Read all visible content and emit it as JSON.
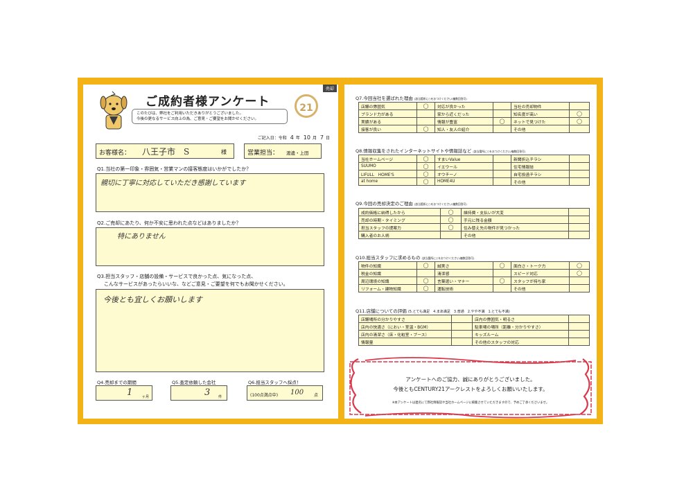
{
  "left": {
    "tag": "売却",
    "title": "ご成約者様アンケート",
    "logo": "21",
    "bubble": [
      "このたびは、弊社をご利用いただきありがとうございました。",
      "今後の更なるサービス向上の為、ご意見・ご要望をお聞かせください。"
    ],
    "date": {
      "prefix": "ご記入日：令和",
      "year": "4",
      "year_unit": "年",
      "month": "10",
      "month_unit": "月",
      "day": "7",
      "day_unit": "日"
    },
    "customer_label": "お客様名：",
    "customer_name": "八王子市　S",
    "customer_suffix": "様",
    "staff_label": "営業担当：",
    "staff_name": "渡邊・上田",
    "q1": "Q1.当社の第一印象・雰囲気・営業マンの接客態度はいかがでしたか？",
    "a1": "親切に丁寧に対応していただき感謝しています",
    "q2": "Q2.ご売却にあたり、何か不安に思われた点などはありましたか？",
    "a2": "特にありません",
    "q3_line1": "Q3.担当スタッフ・店舗の設備・サービスで良かった点、気になった点、",
    "q3_line2": "こんなサービスがあったらいいな、などご意見・ご要望を何でもお聞かせください。",
    "a3": "今後とも宜しくお願いします",
    "q4": "Q4.売却までの期間",
    "a4": "1",
    "a4_unit": "ヶ月",
    "q5": "Q5.査定依頼した会社",
    "a5": "3",
    "a5_unit": "件",
    "q6": "Q6.担当スタッフへ採点！",
    "q6_scale": "(100点満点中)",
    "a6": "100",
    "a6_unit": "点"
  },
  "right": {
    "q7": {
      "title": "Q7.今回当社を選ばれた理由",
      "note": "(該当箇所に○をおつけください/複数回答可)",
      "rows": [
        [
          "店舗の雰囲気",
          "◯",
          "対応が良かった",
          "",
          "当社の売却物件",
          ""
        ],
        [
          "ブランド力がある",
          "",
          "家から近くだった",
          "",
          "知名度が高い",
          "◯"
        ],
        [
          "実績がある",
          "",
          "情報が豊富",
          "◯",
          "ネットで見つけた",
          "◯"
        ],
        [
          "接客が良い",
          "◯",
          "知人・友人の紹介",
          "",
          "その他",
          ""
        ]
      ]
    },
    "q8": {
      "title": "Q8.情報収集をされたインターネットサイトや情報誌など",
      "note": "(該当箇所に○をおつけください/複数回答可)",
      "rows": [
        [
          "当社ホームページ",
          "◯",
          "すまいValue",
          "",
          "新聞折込チラシ",
          ""
        ],
        [
          "SUUMO",
          "◯",
          "イエウール",
          "",
          "住宅情報誌",
          ""
        ],
        [
          "LIFULL　HOME'S",
          "◯",
          "オウチーノ",
          "",
          "自宅投函チラシ",
          ""
        ],
        [
          "at home",
          "◯",
          "HOME4U",
          "",
          "その他",
          ""
        ]
      ]
    },
    "q9": {
      "title": "Q9.今回の売却決定のご理由",
      "note": "(該当箇所に○をおつけください/複数回答可)",
      "rows": [
        [
          "成約価格に納得したから",
          "◯",
          "維持費・支払いが大変",
          ""
        ],
        [
          "売却の時期・タイミング",
          "◯",
          "手元に残る金額",
          ""
        ],
        [
          "担当スタッフの提案力",
          "◯",
          "住み替え先の物件が見つかった",
          ""
        ],
        [
          "購入者のお人柄",
          "",
          "その他",
          ""
        ]
      ]
    },
    "q10": {
      "title": "Q10.担当スタッフに求めるもの",
      "note": "(該当箇所に○をおつけください/複数回答可)",
      "rows": [
        [
          "物件の知識",
          "◯",
          "誠実さ",
          "◯",
          "面白さ・トーク力",
          "◯"
        ],
        [
          "税金の知識",
          "",
          "清潔感",
          "",
          "スピード対応",
          "◯"
        ],
        [
          "周辺環境の知識",
          "◯",
          "言葉遣い・マナー",
          "◯",
          "スタッフが持ち家",
          ""
        ],
        [
          "リフォーム・建物知識",
          "◯",
          "運転技術",
          "",
          "その他",
          ""
        ]
      ]
    },
    "q11": {
      "title": "Q11.店舗についての評価",
      "note": "(5.とても満足　4.まあ満足　3.普通　2.やや不満　1.とても不満)",
      "rows": [
        [
          "店舗場所の分かりやすさ",
          "",
          "店内の雰囲気・明るさ",
          ""
        ],
        [
          "店内の快適さ（におい・室温・BGM）",
          "",
          "駐車場の場所（距離・分かりやすさ）",
          ""
        ],
        [
          "店内の清潔さ（床・化粧室・ブース）",
          "",
          "キッズルーム",
          ""
        ],
        [
          "情報量",
          "",
          "その他のスタッフの対応",
          ""
        ]
      ]
    },
    "thanks1": "アンケートへのご協力、誠にありがとうございました。",
    "thanks2": "今後ともCENTURY21アークレストをよろしくお願いいたします。",
    "footnote": "※本アンケートは匿名にて弊社情報誌や当社ホームページに掲載させていただきますので、予めご了承くださいませ。"
  },
  "colors": {
    "frame": "#f3b316",
    "field": "#fffbd0",
    "ribbon": "#d9374a",
    "logo": "#c8a463"
  }
}
